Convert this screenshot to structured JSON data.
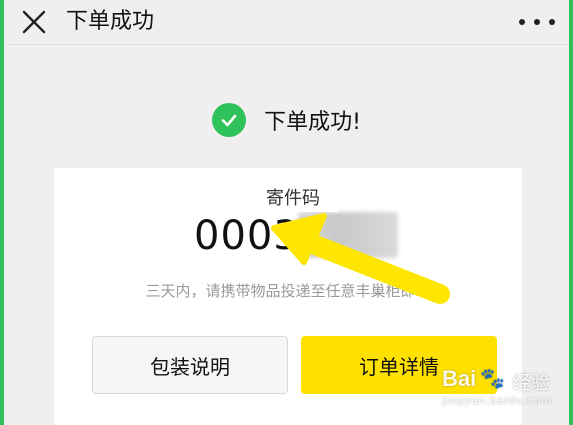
{
  "window": {
    "title": "下单成功"
  },
  "success": {
    "message": "下单成功!"
  },
  "card": {
    "code_label": "寄件码",
    "code_value": "0003",
    "hint": "三天内，请携带物品投递至任意丰巢柜即可"
  },
  "buttons": {
    "packing_label": "包装说明",
    "detail_label": "订单详情"
  },
  "watermark": {
    "brand": "Bai",
    "paw": "🐾",
    "cn": "经验",
    "url": "jingyan.baidu.com"
  },
  "colors": {
    "frame_border": "#2fc25a",
    "check_green": "#2fc25a",
    "detail_button": "#ffe100",
    "arrow_yellow": "#ffe600"
  },
  "icons": {
    "close": "close-icon",
    "more": "more-icon",
    "check": "check-icon",
    "annotation": "arrow-icon"
  }
}
